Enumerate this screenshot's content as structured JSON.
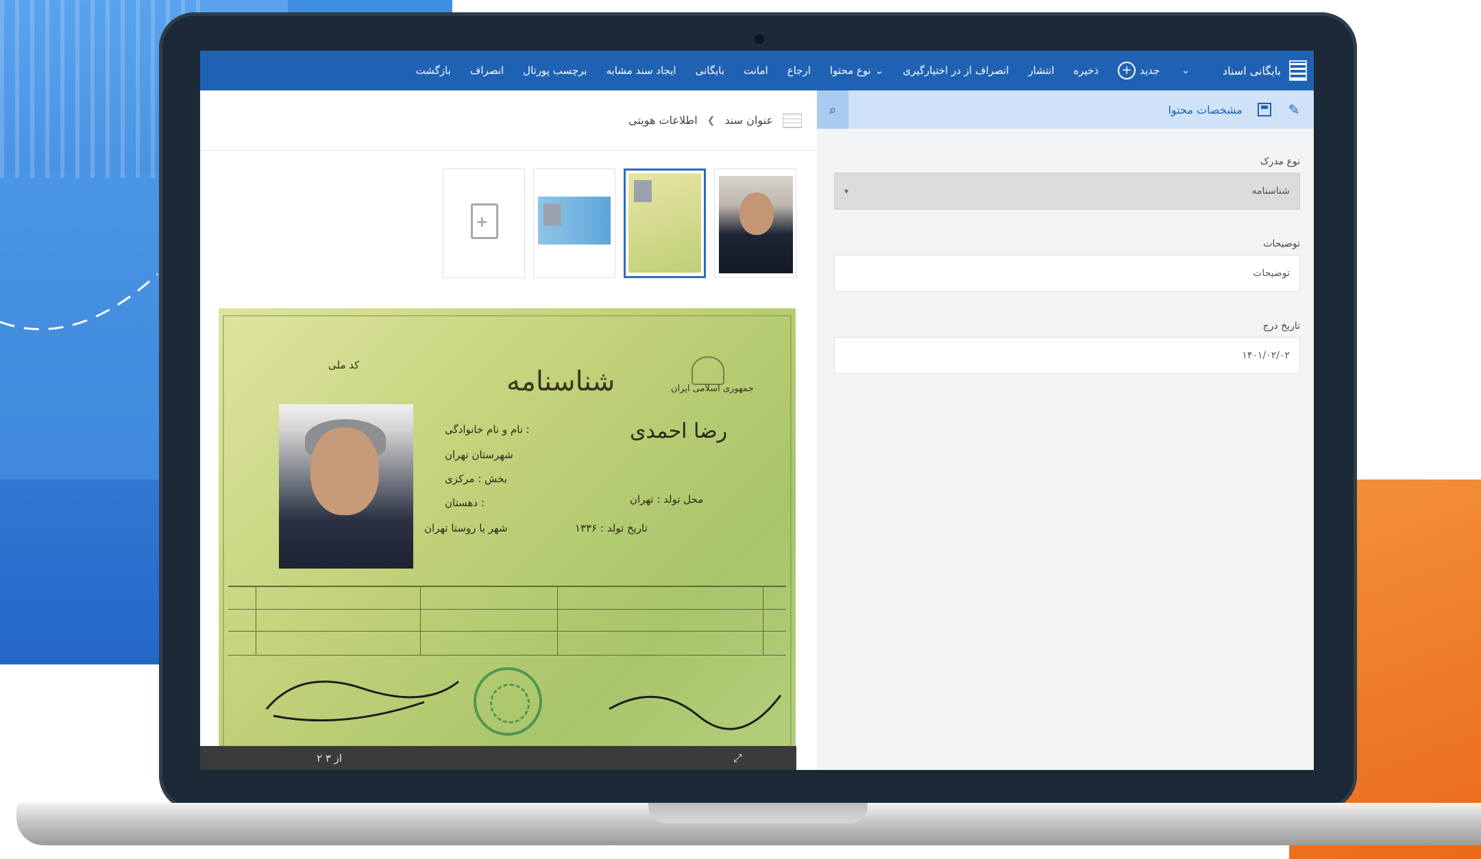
{
  "toolbar": {
    "brand": "بایگانی اسناد",
    "new": "جدید",
    "save": "ذخیره",
    "publish": "انتشار",
    "cancel_checkout": "انصراف از در اختیارگیری",
    "content_type": "نوع محتوا",
    "refer": "ارجاع",
    "properties": "امانت",
    "archive": "بایگانی",
    "create_similar": "ایجاد سند مشابه",
    "portal_label": "برچسب پورتال",
    "discard": "انصراف",
    "return": "بازگشت"
  },
  "breadcrumb": {
    "title": "عنوان سند",
    "current": "اطلاعات هویتی"
  },
  "right_panel": {
    "title": "مشخصات محتوا",
    "fields": [
      {
        "label": "نوع مدرک",
        "value": "شناسنامه"
      },
      {
        "label": "توضیحات",
        "value": "توضیحات"
      },
      {
        "label": "تاریخ درج",
        "value": "۱۴۰۱/۰۲/۰۲"
      }
    ]
  },
  "document": {
    "id_title": "شناسنامه",
    "id_subtitle": "کد ملی",
    "country": "جمهوری اسلامی ایران",
    "holder_name": "رضا احمدی",
    "lines": [
      "نام و نام خانوادگی :",
      "شهرستان تهران",
      "بخش : مرکزی",
      "دهستان :",
      "شهر یا روستا تهران",
      "محل تولد : تهران",
      "تاریخ تولد : ۱۳۳۶"
    ]
  },
  "footer": {
    "pager": "۲ از ۳"
  }
}
